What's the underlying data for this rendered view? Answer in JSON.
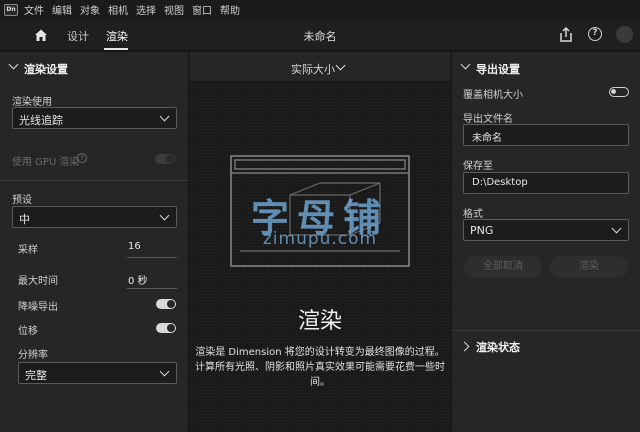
{
  "app": {
    "logo_text": "Dn",
    "doc_title": "未命名"
  },
  "menu": [
    "文件",
    "编辑",
    "对象",
    "相机",
    "选择",
    "视图",
    "窗口",
    "帮助"
  ],
  "header": {
    "tab_design": "设计",
    "tab_render": "渲染",
    "help_glyph": "?"
  },
  "left": {
    "section_title": "渲染设置",
    "render_use_label": "渲染使用",
    "render_use_value": "光线追踪",
    "gpu_label": "使用 GPU 渲染",
    "preset_label": "预设",
    "preset_value": "中",
    "samples_label": "采样",
    "samples_value": "16",
    "max_time_label": "最大时间",
    "max_time_value": "0 秒",
    "denoise_label": "降噪导出",
    "displace_label": "位移",
    "resolution_label": "分辨率",
    "resolution_value": "完整"
  },
  "center": {
    "view_size": "实际大小",
    "watermark_cn": "字母铺",
    "watermark_url": "zimupu.com",
    "empty_title": "渲染",
    "empty_desc": "渲染是 Dimension 将您的设计转变为最终图像的过程。计算所有光照、阴影和照片真实效果可能需要花费一些时间。"
  },
  "right": {
    "section_title": "导出设置",
    "override_label": "覆盖相机大小",
    "filename_label": "导出文件名",
    "filename_value": "未命名",
    "save_to_label": "保存至",
    "save_to_value": "D:\\Desktop",
    "format_label": "格式",
    "format_value": "PNG",
    "cancel_all_label": "全部取消",
    "render_button_label": "渲染",
    "status_title": "渲染状态"
  }
}
